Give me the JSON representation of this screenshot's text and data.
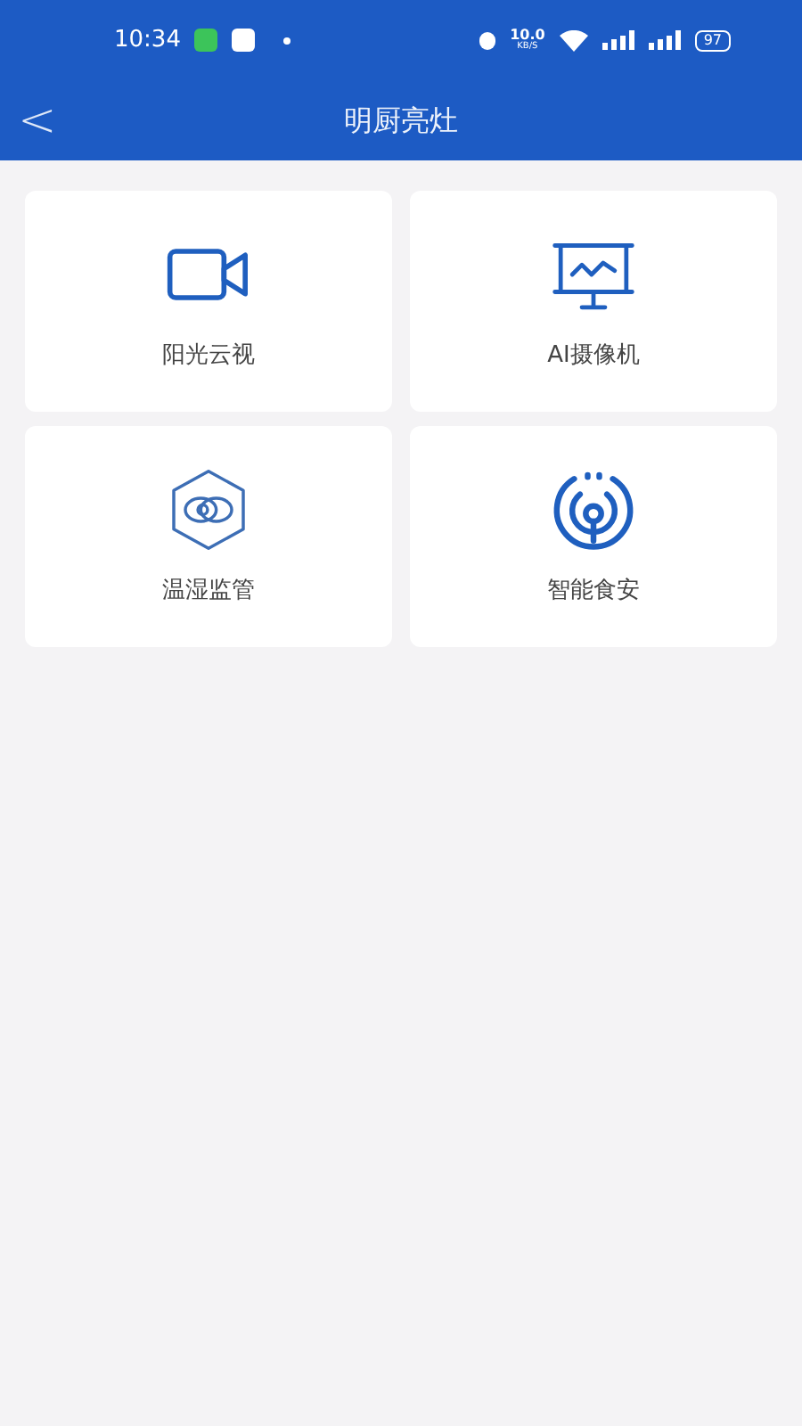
{
  "status_bar": {
    "time": "10:34",
    "net_speed": "10.0",
    "net_unit": "KB/S",
    "battery": "97"
  },
  "header": {
    "back": "<",
    "title": "明厨亮灶"
  },
  "tiles": [
    {
      "kind": "camera",
      "label": "阳光云视"
    },
    {
      "kind": "monitor",
      "label": "AI摄像机"
    },
    {
      "kind": "hexagon",
      "label": "温湿监管"
    },
    {
      "kind": "signal",
      "label": "智能食安"
    }
  ]
}
